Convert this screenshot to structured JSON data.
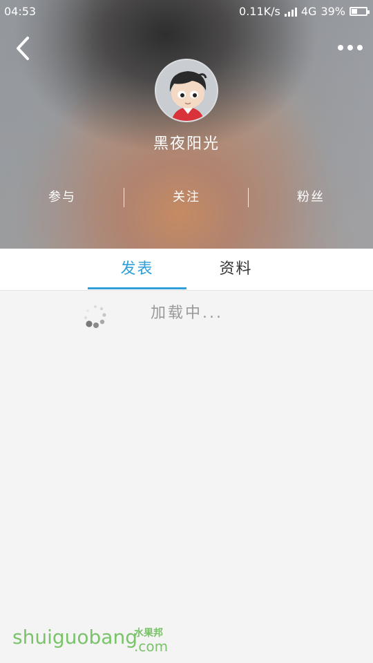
{
  "status_bar": {
    "time": "04:53",
    "speed": "0.11K/s",
    "network": "4G",
    "battery_text": "39%",
    "battery_level": 0.39
  },
  "header": {
    "back_icon": "chevron-left-icon",
    "more_icon": "more-horizontal-icon"
  },
  "profile": {
    "username": "黑夜阳光",
    "stats": [
      {
        "label": "参与"
      },
      {
        "label": "关注"
      },
      {
        "label": "粉丝"
      }
    ]
  },
  "tabs": [
    {
      "label": "发表",
      "active": true
    },
    {
      "label": "资料",
      "active": false
    }
  ],
  "content": {
    "loading_text": "加载中..."
  },
  "watermark": {
    "text": "shuiguobang",
    "cn": "水果邦",
    "domain": ".com"
  },
  "colors": {
    "accent": "#2e9fd8",
    "watermark": "#7ac36a"
  }
}
